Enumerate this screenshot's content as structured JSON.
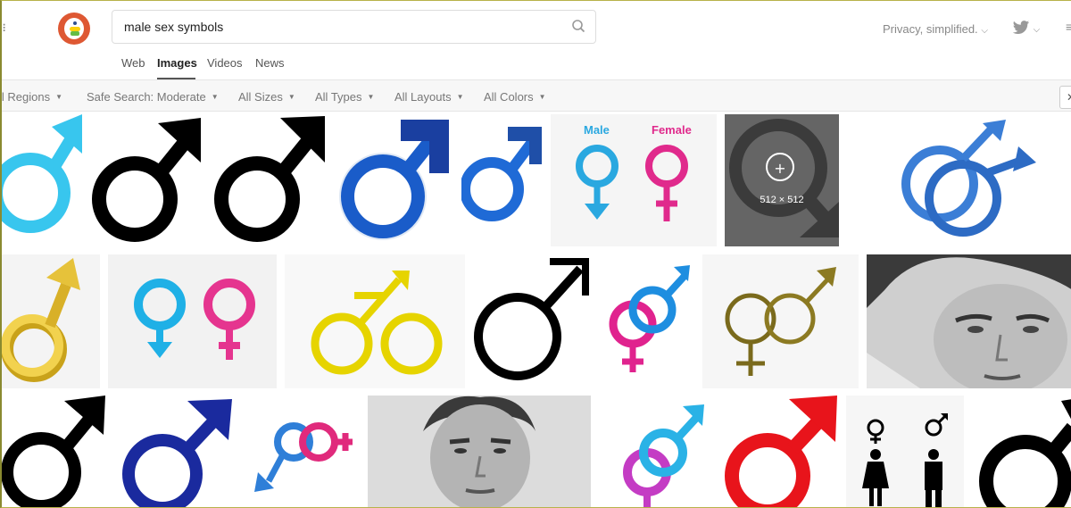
{
  "search": {
    "query": "male sex symbols"
  },
  "tabs": [
    {
      "label": "Web"
    },
    {
      "label": "Images"
    },
    {
      "label": "Videos"
    },
    {
      "label": "News"
    }
  ],
  "header_right": {
    "privacy_label": "Privacy, simplified."
  },
  "filters": [
    {
      "label": "ll Regions"
    },
    {
      "label": "Safe Search: Moderate"
    },
    {
      "label": "All Sizes"
    },
    {
      "label": "All Types"
    },
    {
      "label": "All Layouts"
    },
    {
      "label": "All Colors"
    }
  ],
  "results": {
    "hover_tile": {
      "dimensions": "512 × 512"
    },
    "labels": {
      "male": "Male",
      "female": "Female"
    }
  },
  "colors": {
    "accent": "#de5833",
    "filter_bg": "#f7f7f7"
  }
}
